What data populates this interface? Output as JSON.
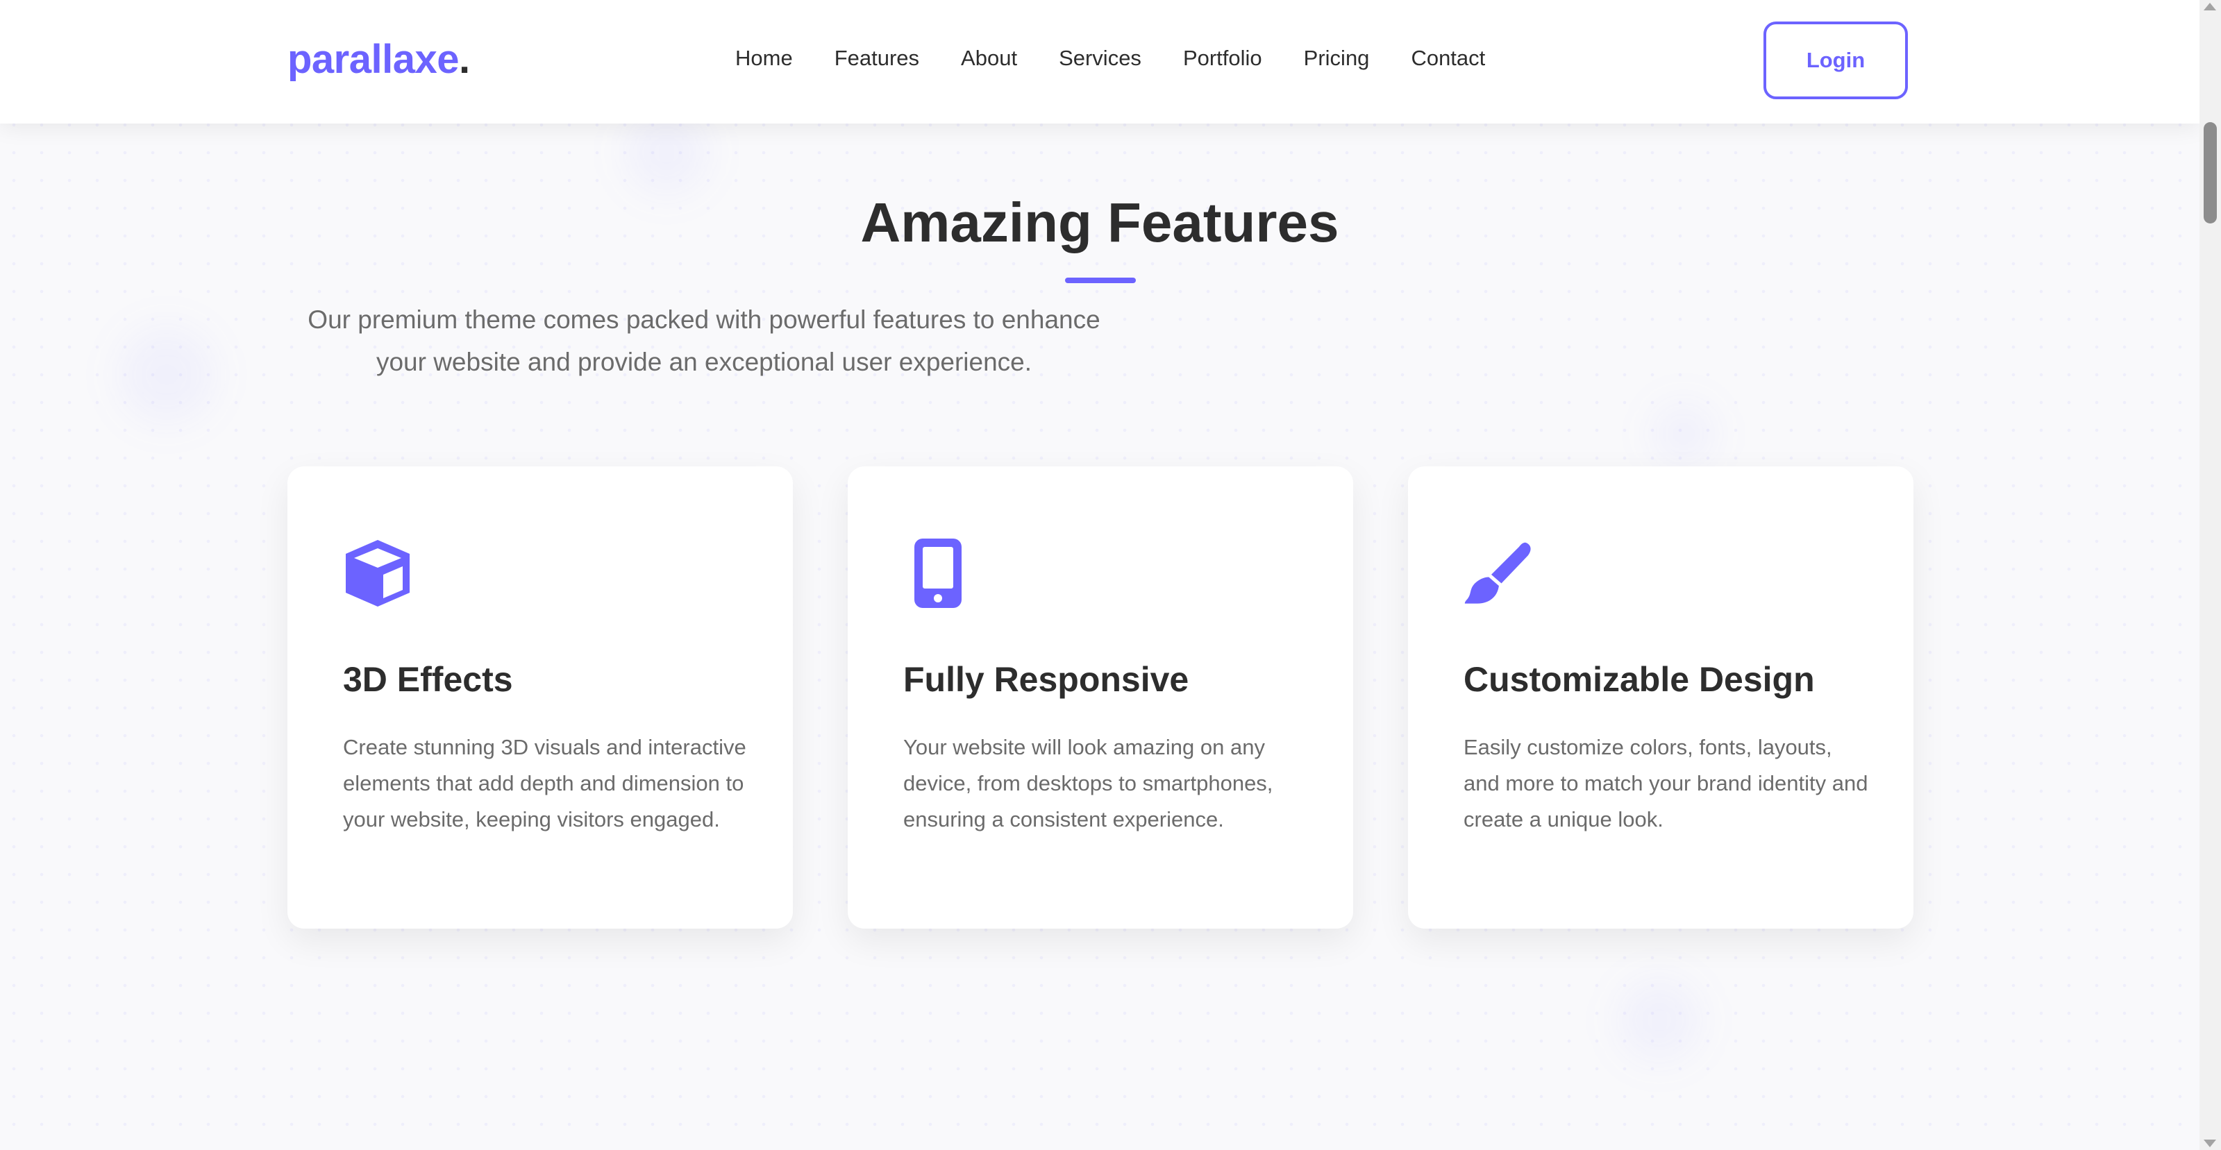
{
  "brand": {
    "name": "parallaxe",
    "dot": "."
  },
  "nav": {
    "items": [
      {
        "label": "Home"
      },
      {
        "label": "Features"
      },
      {
        "label": "About"
      },
      {
        "label": "Services"
      },
      {
        "label": "Portfolio"
      },
      {
        "label": "Pricing"
      },
      {
        "label": "Contact"
      }
    ],
    "login_label": "Login"
  },
  "features": {
    "title": "Amazing Features",
    "subtitle_line1": "Our premium theme comes packed with powerful features to enhance",
    "subtitle_line2": "your website and provide an exceptional user experience.",
    "cards": [
      {
        "icon": "cube-icon",
        "title": "3D Effects",
        "text": "Create stunning 3D visuals and interactive elements that add depth and dimension to your website, keeping visitors engaged."
      },
      {
        "icon": "mobile-phone-icon",
        "title": "Fully Responsive",
        "text": "Your website will look amazing on any device, from desktops to smartphones, ensuring a consistent experience."
      },
      {
        "icon": "paint-brush-icon",
        "title": "Customizable Design",
        "text": "Easily customize colors, fonts, layouts, and more to match your brand identity and create a unique look."
      }
    ]
  },
  "colors": {
    "accent": "#6c63ff",
    "heading": "#2d2d2d",
    "body_text": "#6b6b6b",
    "background": "#f9f9fb"
  }
}
